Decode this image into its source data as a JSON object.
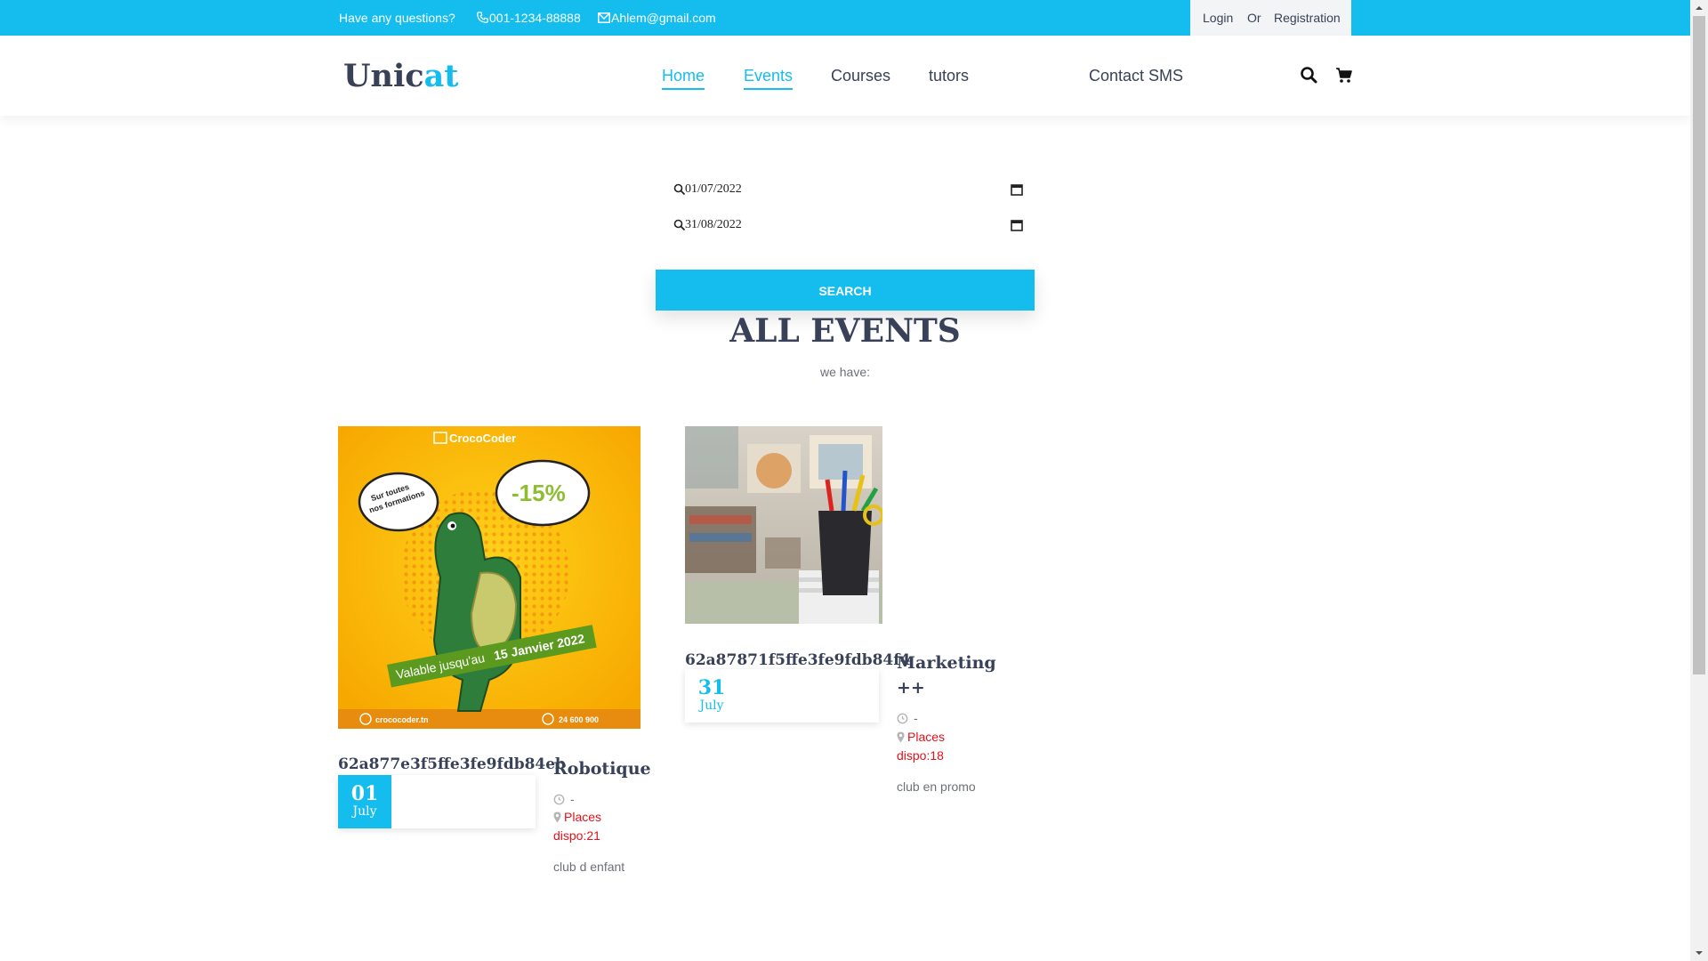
{
  "topbar": {
    "question": "Have any questions?",
    "phone": "001-1234-88888",
    "email": "Ahlem@gmail.com",
    "login": "Login",
    "or": "Or",
    "registration": "Registration"
  },
  "header": {
    "logo_main": "Unic",
    "logo_accent": "at",
    "nav": [
      "Home",
      "Events",
      "Courses",
      "tutors",
      "Contact SMS"
    ]
  },
  "search": {
    "date_from": "01/07/2022",
    "date_to": "31/08/2022",
    "button": "SEARCH"
  },
  "section": {
    "title": "ALL EVENTS",
    "subtitle": "we have:"
  },
  "events": [
    {
      "id": "62a877e3f5ffe3fe9fdb84eb",
      "day": "01",
      "month": "July",
      "title": "Robotique",
      "time": "-",
      "places_label": "Places",
      "places": "dispo:21",
      "description": "club d enfant",
      "poster": {
        "brand": "CrocoCoder",
        "bubble_left": "Sur toutes nos formations",
        "discount": "-15%",
        "banner_a": "Valable jusqu'au",
        "banner_b": "15 Janvier 2022",
        "site": "crococoder.tn",
        "phone": "24 600 900"
      }
    },
    {
      "id": "62a87871f5ffe3fe9fdb84f4",
      "day": "31",
      "month": "July",
      "title": "Marketing ++",
      "time": "-",
      "places_label": "Places",
      "places": "dispo:18",
      "description": "club en promo"
    }
  ],
  "colors": {
    "accent": "#14bdee",
    "text": "#384158",
    "red": "#e3111b"
  }
}
